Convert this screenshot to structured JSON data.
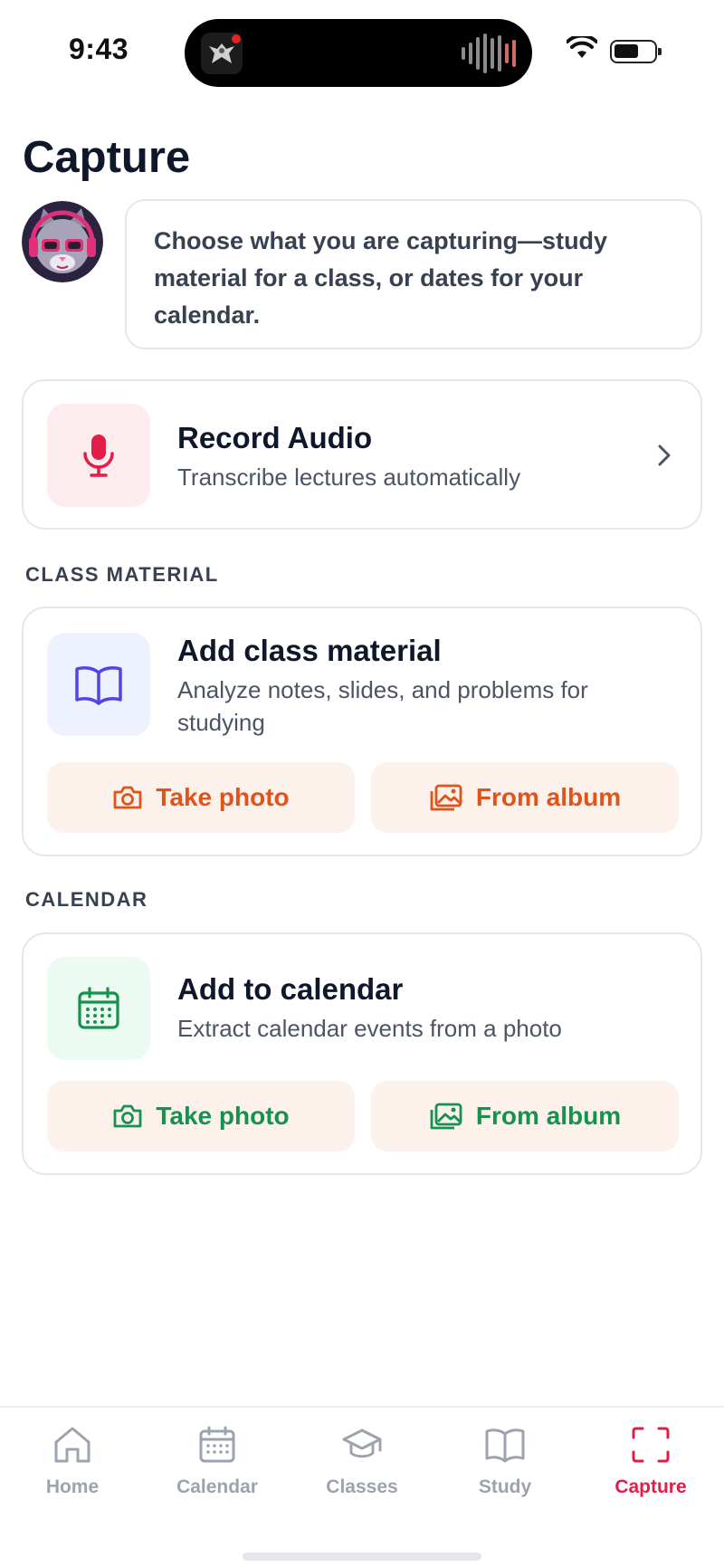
{
  "status_bar": {
    "time": "9:43"
  },
  "page": {
    "title": "Capture"
  },
  "assistant": {
    "message": "Choose what you are capturing—study material for a class, or dates for your calendar."
  },
  "record_audio": {
    "title": "Record Audio",
    "subtitle": "Transcribe lectures automatically",
    "icon": "microphone-icon",
    "accent": "#e11d48"
  },
  "class_material": {
    "section_label": "CLASS MATERIAL",
    "title": "Add class material",
    "subtitle": "Analyze notes, slides, and problems for studying",
    "icon": "book-open-icon",
    "take_photo": "Take photo",
    "from_album": "From album",
    "accent": "#e0541c"
  },
  "calendar": {
    "section_label": "CALENDAR",
    "title": "Add to calendar",
    "subtitle": "Extract calendar events from a photo",
    "icon": "calendar-icon",
    "take_photo": "Take photo",
    "from_album": "From album",
    "accent": "#15924f"
  },
  "tab_bar": {
    "items": [
      {
        "label": "Home",
        "icon": "home-icon",
        "active": false
      },
      {
        "label": "Calendar",
        "icon": "calendar-icon",
        "active": false
      },
      {
        "label": "Classes",
        "icon": "graduation-cap-icon",
        "active": false
      },
      {
        "label": "Study",
        "icon": "book-open-icon",
        "active": false
      },
      {
        "label": "Capture",
        "icon": "scan-icon",
        "active": true
      }
    ],
    "active_color": "#e11d48",
    "inactive_color": "#9ca3af"
  }
}
